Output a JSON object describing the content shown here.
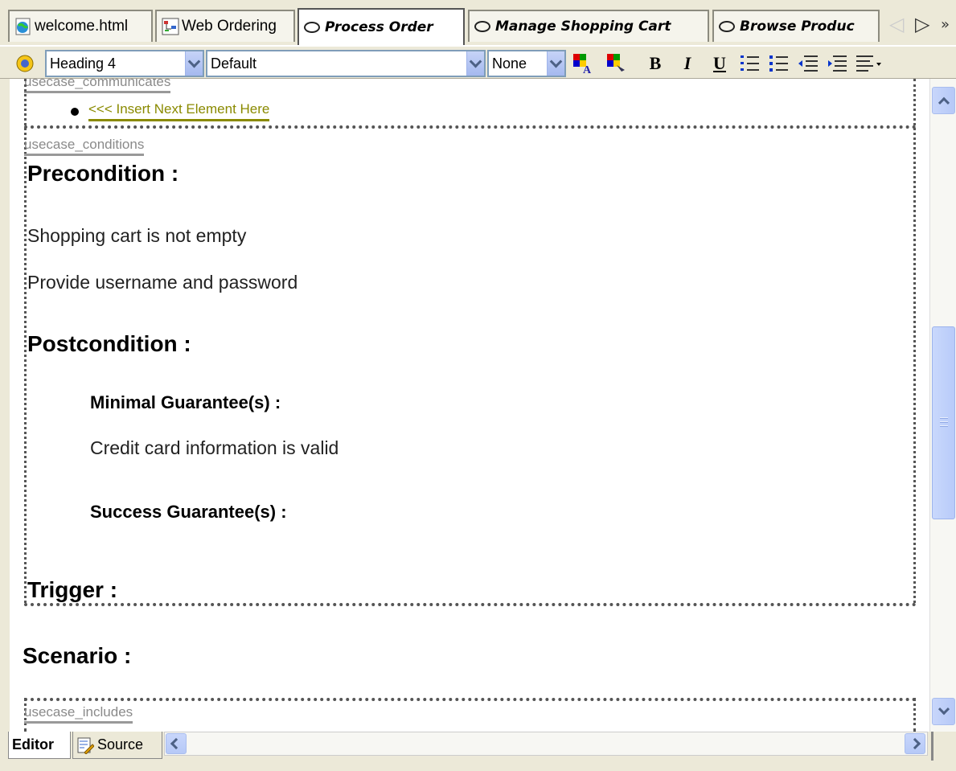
{
  "tabs": [
    {
      "label": "welcome.html",
      "icon": "globe-document-icon",
      "active": false
    },
    {
      "label": "Web Ordering",
      "icon": "diagram-icon",
      "active": false
    },
    {
      "label": "Process Order",
      "icon": "usecase-oval-icon",
      "active": true
    },
    {
      "label": "Manage Shopping Cart",
      "icon": "usecase-oval-icon",
      "active": false
    },
    {
      "label": "Browse Produc",
      "icon": "usecase-oval-icon",
      "active": false
    }
  ],
  "toolbar": {
    "paragraph_style": "Heading 4",
    "font": "Default",
    "size": "None",
    "bold": "B",
    "italic": "I",
    "underline": "U"
  },
  "editor": {
    "communicates_label": "usecase_communicates",
    "insert_placeholder": "<<< Insert Next Element Here",
    "conditions_label": "usecase_conditions",
    "precondition_heading": "Precondition :",
    "precondition_items": [
      "Shopping cart is not empty",
      "Provide username and password"
    ],
    "postcondition_heading": "Postcondition :",
    "minimal_heading": "Minimal Guarantee(s) :",
    "minimal_text": "Credit card information is valid",
    "success_heading": "Success Guarantee(s) :",
    "trigger_heading": "Trigger :",
    "scenario_heading": "Scenario :",
    "includes_label": "usecase_includes"
  },
  "bottom_tabs": {
    "editor": "Editor",
    "source": "Source"
  },
  "colors": {
    "chrome": "#ece9d8",
    "scroll_blue": "#b6c9f7",
    "placeholder_olive": "#8a8a00"
  }
}
